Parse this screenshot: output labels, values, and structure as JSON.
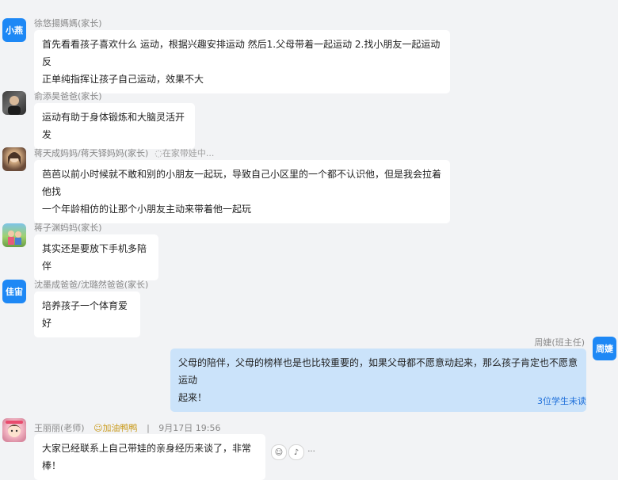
{
  "messages": [
    {
      "sender": "徐悠揚媽媽(家长)",
      "avatar_text": "小燕",
      "text_line1": "首先看看孩子喜欢什么 运动，根据兴趣安排运动  然后1.父母带着一起运动 2.找小朋友一起运动  反",
      "text_line2": "正单纯指挥让孩子自己运动，效果不大"
    },
    {
      "sender": "俞添昊爸爸(家长)",
      "avatar_icon": "person-photo-icon",
      "text": "运动有助于身体锻炼和大脑灵活开发"
    },
    {
      "sender": "蒋天成妈妈/蒋天铎妈妈(家长)",
      "sender_extra": "◌在家带娃中...",
      "avatar_icon": "person-photo-icon",
      "text_line1": "芭芭以前小时候就不敢和别的小朋友一起玩，导致自己小区里的一个都不认识他，但是我会拉着他找",
      "text_line2": "一个年龄相仿的让那个小朋友主动来带着他一起玩"
    },
    {
      "sender": "蒋子渊妈妈(家长)",
      "avatar_icon": "landscape-photo-icon",
      "text": "其实还是要放下手机多陪伴"
    },
    {
      "sender": "沈墨成爸爸/沈璐然爸爸(家长)",
      "avatar_text": "佳宙",
      "text": "培养孩子一个体育爱好"
    },
    {
      "sender": "周婕(班主任)",
      "avatar_text": "周婕",
      "text_line1": "父母的陪伴，父母的榜样也是也比较重要的，如果父母都不愿意动起来，那么孩子肯定也不愿意运动",
      "text_line2": "起来！",
      "read_status": "3位学生未读"
    },
    {
      "sender": "王丽丽(老师)",
      "sender_badge": "☺加油鸭鸭",
      "sender_sep": "|",
      "sender_time": "9月17日  19:56",
      "avatar_icon": "cartoon-avatar-icon",
      "text": "大家已经联系上自己带娃的亲身经历来谈了，非常棒！",
      "actions": [
        "☺",
        "♪",
        "···"
      ]
    }
  ]
}
